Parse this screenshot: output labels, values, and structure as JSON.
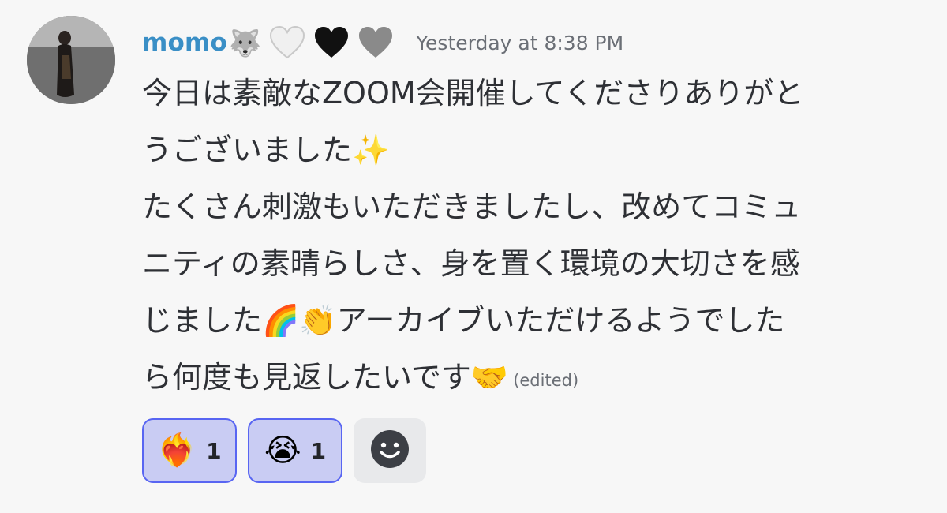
{
  "message": {
    "username": "momo",
    "name_emojis": [
      "🐺",
      "🤍",
      "🖤",
      "🩶"
    ],
    "timestamp": "Yesterday at 8:38 PM",
    "lines": [
      "今日は素敵なZOOM会開催してくださりありがと",
      "うございました✨",
      "たくさん刺激もいただきましたし、改めてコミュ",
      "ニティの素晴らしさ、身を置く環境の大切さを感",
      "じました🌈👏アーカイブいただけるようでした",
      "ら何度も見返したいです🤝"
    ],
    "edited_label": "(edited)"
  },
  "reactions": [
    {
      "emoji": "❤️‍🔥",
      "count": "1"
    },
    {
      "emoji": "😭",
      "count": "1"
    }
  ],
  "add_reaction_icon": "smiley-face-icon",
  "colors": {
    "username": "#3a8fc6",
    "reaction_border": "#5865f2",
    "reaction_bg": "#c9ccf3",
    "timestamp": "#6b6f76",
    "background": "#f7f7f7"
  }
}
